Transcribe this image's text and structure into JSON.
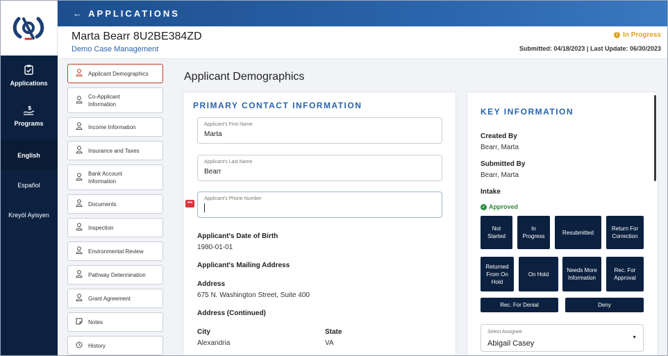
{
  "topbar": {
    "back_label": "← APPLICATIONS"
  },
  "header": {
    "case_name": "Marta Bearr 8U2BE384ZD",
    "case_subtitle": "Demo Case Management",
    "status": "In Progress",
    "dates": "Submitted: 04/18/2023 | Last Update: 06/30/2023"
  },
  "rail": {
    "items": [
      {
        "label": "Applications",
        "icon": "clipboard-check-icon"
      },
      {
        "label": "Programs",
        "icon": "money-hand-icon"
      }
    ],
    "languages": [
      "English",
      "Español",
      "Kreyòl Ayisyen"
    ],
    "active_language": "English"
  },
  "nav": {
    "items": [
      {
        "label": "Applicant Demographics",
        "icon": "user-icon"
      },
      {
        "label": "Co-Applicant Information",
        "icon": "user-icon"
      },
      {
        "label": "Income Information",
        "icon": "user-icon"
      },
      {
        "label": "Insurance and Taxes",
        "icon": "user-icon"
      },
      {
        "label": "Bank Account Information",
        "icon": "user-icon"
      },
      {
        "label": "Documents",
        "icon": "user-icon"
      },
      {
        "label": "Inspection",
        "icon": "user-icon"
      },
      {
        "label": "Environmental Review",
        "icon": "user-icon"
      },
      {
        "label": "Pathway Determination",
        "icon": "user-icon"
      },
      {
        "label": "Grant Agreement",
        "icon": "user-icon"
      },
      {
        "label": "Notes",
        "icon": "note-icon"
      },
      {
        "label": "History",
        "icon": "clock-icon"
      }
    ],
    "active": "Applicant Demographics"
  },
  "main": {
    "page_title": "Applicant Demographics",
    "section_title": "PRIMARY CONTACT INFORMATION",
    "fields": {
      "first_name": {
        "label": "Applicant's First Name",
        "value": "Marta"
      },
      "last_name": {
        "label": "Applicant's Last Name",
        "value": "Bearr"
      },
      "phone": {
        "label": "Applicant's Phone Number",
        "value": ""
      }
    },
    "dob_label": "Applicant's Date of Birth",
    "dob_value": "1980-01-01",
    "mailing_label": "Applicant's Mailing Address",
    "address_label": "Address",
    "address_value": "675 N. Washington Street, Suite 400",
    "address2_label": "Address (Continued)",
    "city_label": "City",
    "city_value": "Alexandria",
    "state_label": "State",
    "state_value": "VA"
  },
  "key_info": {
    "title": "KEY INFORMATION",
    "created_by_label": "Created By",
    "created_by_value": "Bearr, Marta",
    "submitted_by_label": "Submitted By",
    "submitted_by_value": "Bearr, Marta",
    "intake_label": "Intake",
    "intake_status": "Approved",
    "buttons": {
      "not_started": "Not Started",
      "in_progress": "In Progress",
      "resubmitted": "Resubmitted",
      "return_for_correction": "Return For Correction",
      "returned_from_on_hold": "Returned From On Hold",
      "on_hold": "On Hold",
      "needs_more_information": "Needs More Information",
      "rec_for_approval": "Rec. For Approval",
      "rec_for_denial": "Rec. For Denial",
      "deny": "Deny"
    },
    "assignee": {
      "label": "Select Assignee",
      "value": "Abigail Casey"
    }
  },
  "colors": {
    "navy": "#0c2140",
    "accent_blue": "#2a64aa",
    "status_amber": "#e0a21a",
    "approved_green": "#2e8b3a",
    "error_red": "#d9363e"
  }
}
